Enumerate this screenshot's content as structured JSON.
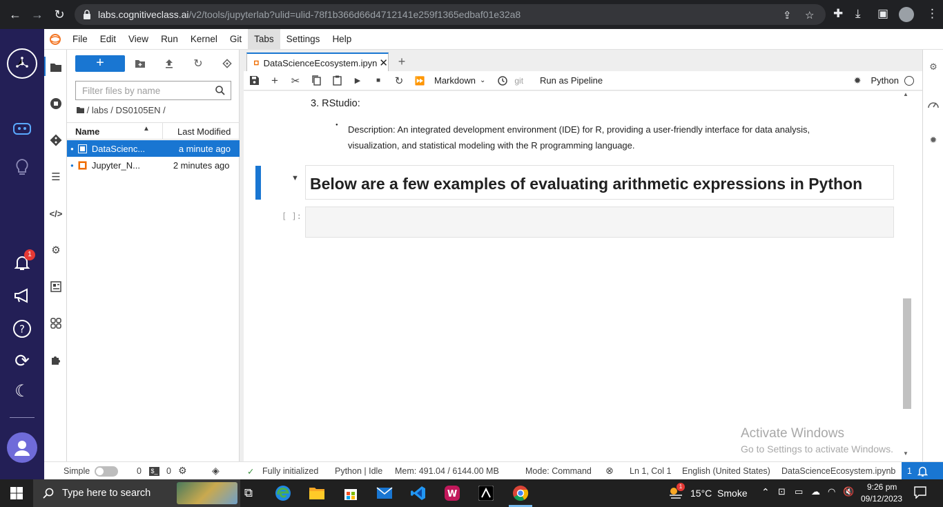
{
  "browser": {
    "url_host": "labs.cognitiveclass.ai",
    "url_path": "/v2/tools/jupyterlab?ulid=ulid-78f1b366d66d4712141e259f1365edbaf01e32a8"
  },
  "cc_sidebar": {
    "notification_count": "1"
  },
  "menubar": {
    "items": [
      "File",
      "Edit",
      "View",
      "Run",
      "Kernel",
      "Git",
      "Tabs",
      "Settings",
      "Help"
    ]
  },
  "file_browser": {
    "new_label": "+",
    "filter_placeholder": "Filter files by name",
    "breadcrumb": "/ labs / DS0105EN /",
    "col_name": "Name",
    "col_modified": "Last Modified",
    "files": [
      {
        "name": "DataScienc...",
        "modified": "a minute ago"
      },
      {
        "name": "Jupyter_N...",
        "modified": "2 minutes ago"
      }
    ]
  },
  "notebook": {
    "tab_title": "DataScienceEcosystem.ipyn",
    "cell_type": "Markdown",
    "git_label": "git",
    "pipeline_label": "Run as Pipeline",
    "kernel_name": "Python",
    "list_item_number": "3.",
    "list_item_title": "RStudio:",
    "description": "Description: An integrated development environment (IDE) for R, providing a user-friendly interface for data analysis, visualization, and statistical modeling with the R programming language.",
    "heading": "Below are a few examples of evaluating arithmetic expressions in Python",
    "prompt": "[ ]:"
  },
  "statusbar": {
    "mode_simple": "Simple",
    "terminals": "0",
    "kernels": "0",
    "init_status": "Fully initialized",
    "kernel_status": "Python | Idle",
    "memory": "Mem: 491.04 / 6144.00 MB",
    "mode": "Mode: Command",
    "cursor": "Ln 1, Col 1",
    "language": "English (United States)",
    "filename": "DataScienceEcosystem.ipynb",
    "notif_count": "1"
  },
  "watermark": {
    "title": "Activate Windows",
    "subtitle": "Go to Settings to activate Windows."
  },
  "taskbar": {
    "search_placeholder": "Type here to search",
    "weather": "15°C  Smoke",
    "weather_badge": "1",
    "time": "9:26 pm",
    "date": "09/12/2023"
  },
  "colors": {
    "accent": "#1976d2",
    "cc_sidebar": "#231f56",
    "chrome": "#202124",
    "taskbar": "#202020"
  }
}
